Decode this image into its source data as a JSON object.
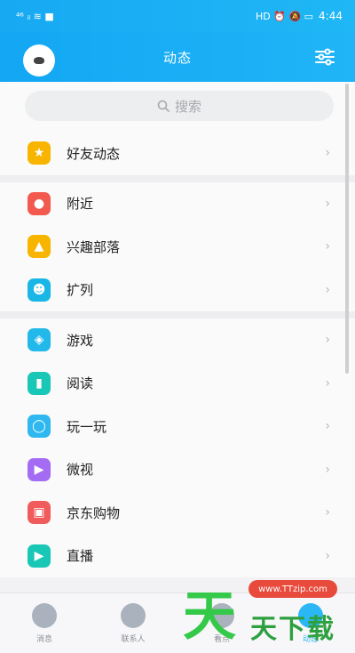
{
  "status_bar": {
    "left": "⁴⁶ ᵢₗ ≋ ■",
    "right": "HD ⏰ 🔕 ▭",
    "time": "4:44"
  },
  "nav": {
    "title": "动态"
  },
  "search": {
    "placeholder": "搜索"
  },
  "groups": [
    [
      {
        "label": "好友动态",
        "icon": "star-icon",
        "color": "#f7b500"
      }
    ],
    [
      {
        "label": "附近",
        "icon": "location-pin-icon",
        "color": "#f2594f"
      },
      {
        "label": "兴趣部落",
        "icon": "tent-icon",
        "color": "#f7b500"
      },
      {
        "label": "扩列",
        "icon": "expand-friends-icon",
        "color": "#19b6e6"
      }
    ],
    [
      {
        "label": "游戏",
        "icon": "gamepad-icon",
        "color": "#22b8ea"
      },
      {
        "label": "阅读",
        "icon": "book-icon",
        "color": "#19c7b7"
      },
      {
        "label": "玩一玩",
        "icon": "planet-icon",
        "color": "#2fb7ef"
      },
      {
        "label": "微视",
        "icon": "play-icon",
        "color": "#a46cf2"
      },
      {
        "label": "京东购物",
        "icon": "shopping-bag-icon",
        "color": "#f05b5b"
      },
      {
        "label": "直播",
        "icon": "live-icon",
        "color": "#19c7b7"
      }
    ]
  ],
  "tabs": [
    {
      "label": "消息",
      "active": false
    },
    {
      "label": "联系人",
      "active": false
    },
    {
      "label": "看点",
      "active": false
    },
    {
      "label": "动态",
      "active": true
    }
  ],
  "watermark": {
    "url": "www.TTzip.com",
    "big": "天",
    "text": "天下载"
  }
}
